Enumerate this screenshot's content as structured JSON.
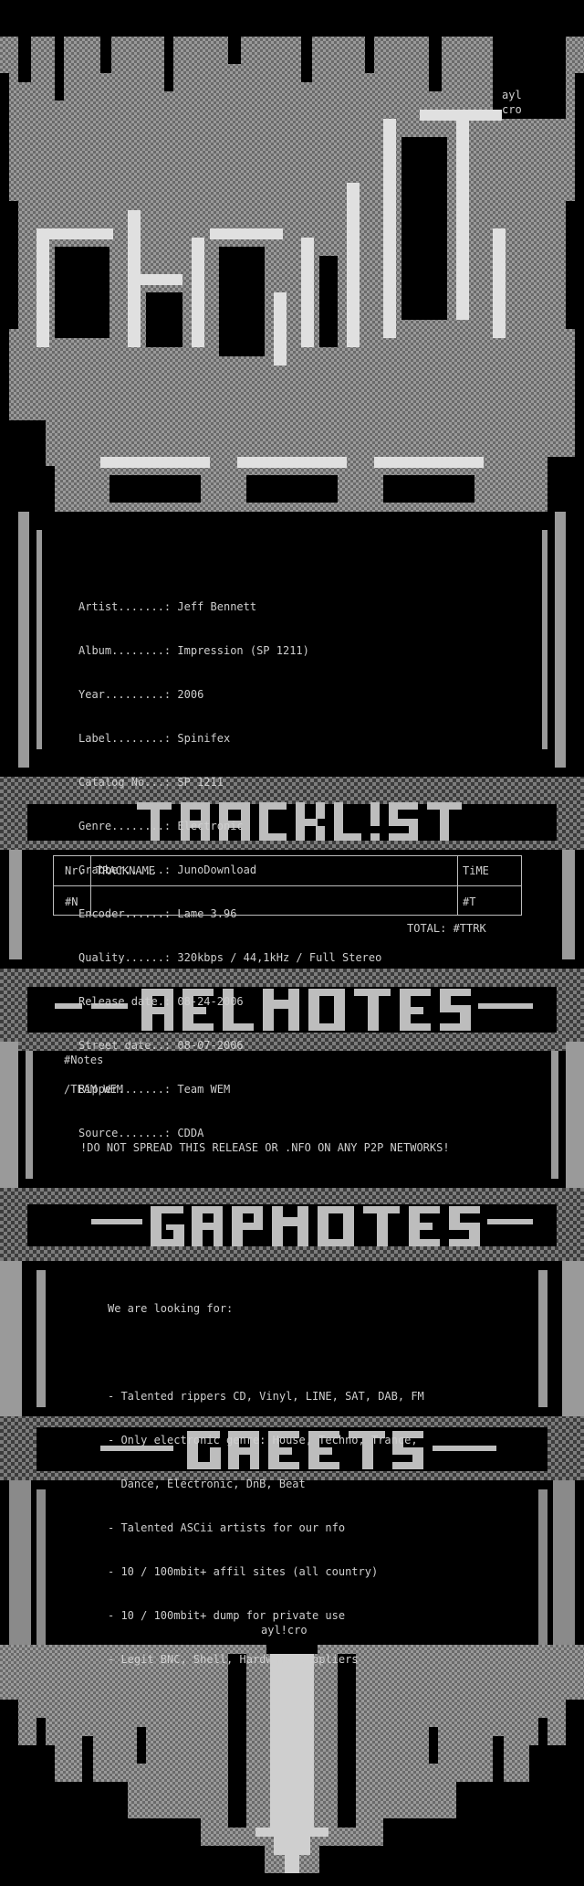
{
  "signature": "ayl!cro",
  "signature_top": [
    "ayl",
    "cro"
  ],
  "section_titles": [
    "TRACKL!ST",
    "RELNOTES",
    "GRPNOTES",
    "GREETS"
  ],
  "info": [
    {
      "label": "Artist.......:",
      "value": "Jeff Bennett"
    },
    {
      "label": "Album........:",
      "value": "Impression (SP 1211)"
    },
    {
      "label": "Year.........:",
      "value": "2006"
    },
    {
      "label": "Label........:",
      "value": "Spinifex"
    },
    {
      "label": "Catalog No...:",
      "value": "SP 1211"
    },
    {
      "label": "Genre........:",
      "value": "Electronic"
    },
    {
      "label": "Grabber......:",
      "value": "JunoDownload"
    },
    {
      "label": "Encoder......:",
      "value": "Lame 3.96"
    },
    {
      "label": "Quality......:",
      "value": "320kbps / 44,1kHz / Full Stereo"
    },
    {
      "label": "Release date.:",
      "value": "08-24-2006"
    },
    {
      "label": "Street date..:",
      "value": "08-07-2006"
    },
    {
      "label": "Ripper.......:",
      "value": "Team WEM"
    },
    {
      "label": "Source.......:",
      "value": "CDDA"
    }
  ],
  "tracklist": {
    "headers": {
      "nr": "Nr.",
      "name": "TRACKNAME",
      "time": "TiME"
    },
    "rows": [
      {
        "nr": "#N",
        "name": "",
        "time": "#T"
      }
    ],
    "total": "TOTAL: #TTRK"
  },
  "relnotes": {
    "notes": "#Notes",
    "signoff": "/TEAM WEM",
    "warning": "!DO NOT SPREAD THIS RELEASE OR .NFO ON ANY P2P NETWORKS!"
  },
  "grpnotes": {
    "intro": "We are looking for:",
    "items": [
      "- Talented rippers CD, Vinyl, LINE, SAT, DAB, FM",
      "- Only electronic genre: House, Techno, Trance,",
      "  Dance, Electronic, DnB, Beat",
      "- Talented ASCii artists for our nfo",
      "- 10 / 100mbit+ affil sites (all country)",
      "- 10 / 100mbit+ dump for private use",
      "- Legit BNC, Shell, Hardware suppliers"
    ]
  },
  "colors": {
    "background": "#000000",
    "text": "#cfcfcf",
    "art_light": "#bdbdbd",
    "art_mid": "#8a8a8a",
    "art_dark": "#5a5a5a"
  }
}
